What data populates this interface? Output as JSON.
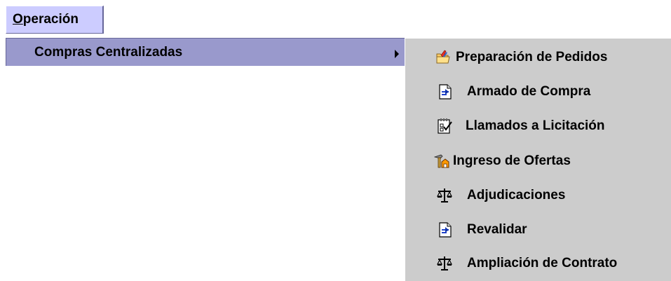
{
  "menubar": {
    "menu": {
      "mnemonic": "O",
      "rest": "peración"
    }
  },
  "dropdown": {
    "item": {
      "label": "Compras Centralizadas",
      "submenu_arrow": "triangle-right-icon"
    }
  },
  "submenu": {
    "items": [
      {
        "label": "Preparación de Pedidos",
        "icon": "folder-edit-icon"
      },
      {
        "label": "Armado de Compra",
        "icon": "document-icon"
      },
      {
        "label": "Llamados a Licitación",
        "icon": "notepad-check-icon"
      },
      {
        "label": "Ingreso de Ofertas",
        "icon": "hammer-house-icon"
      },
      {
        "label": "Adjudicaciones",
        "icon": "scales-icon"
      },
      {
        "label": "Revalidar",
        "icon": "document-icon"
      },
      {
        "label": "Ampliación de Contrato",
        "icon": "scales-icon"
      }
    ]
  },
  "colors": {
    "menu_selected": "#ccccff",
    "item_highlight": "#9999cc",
    "submenu_background": "#cccccc"
  }
}
